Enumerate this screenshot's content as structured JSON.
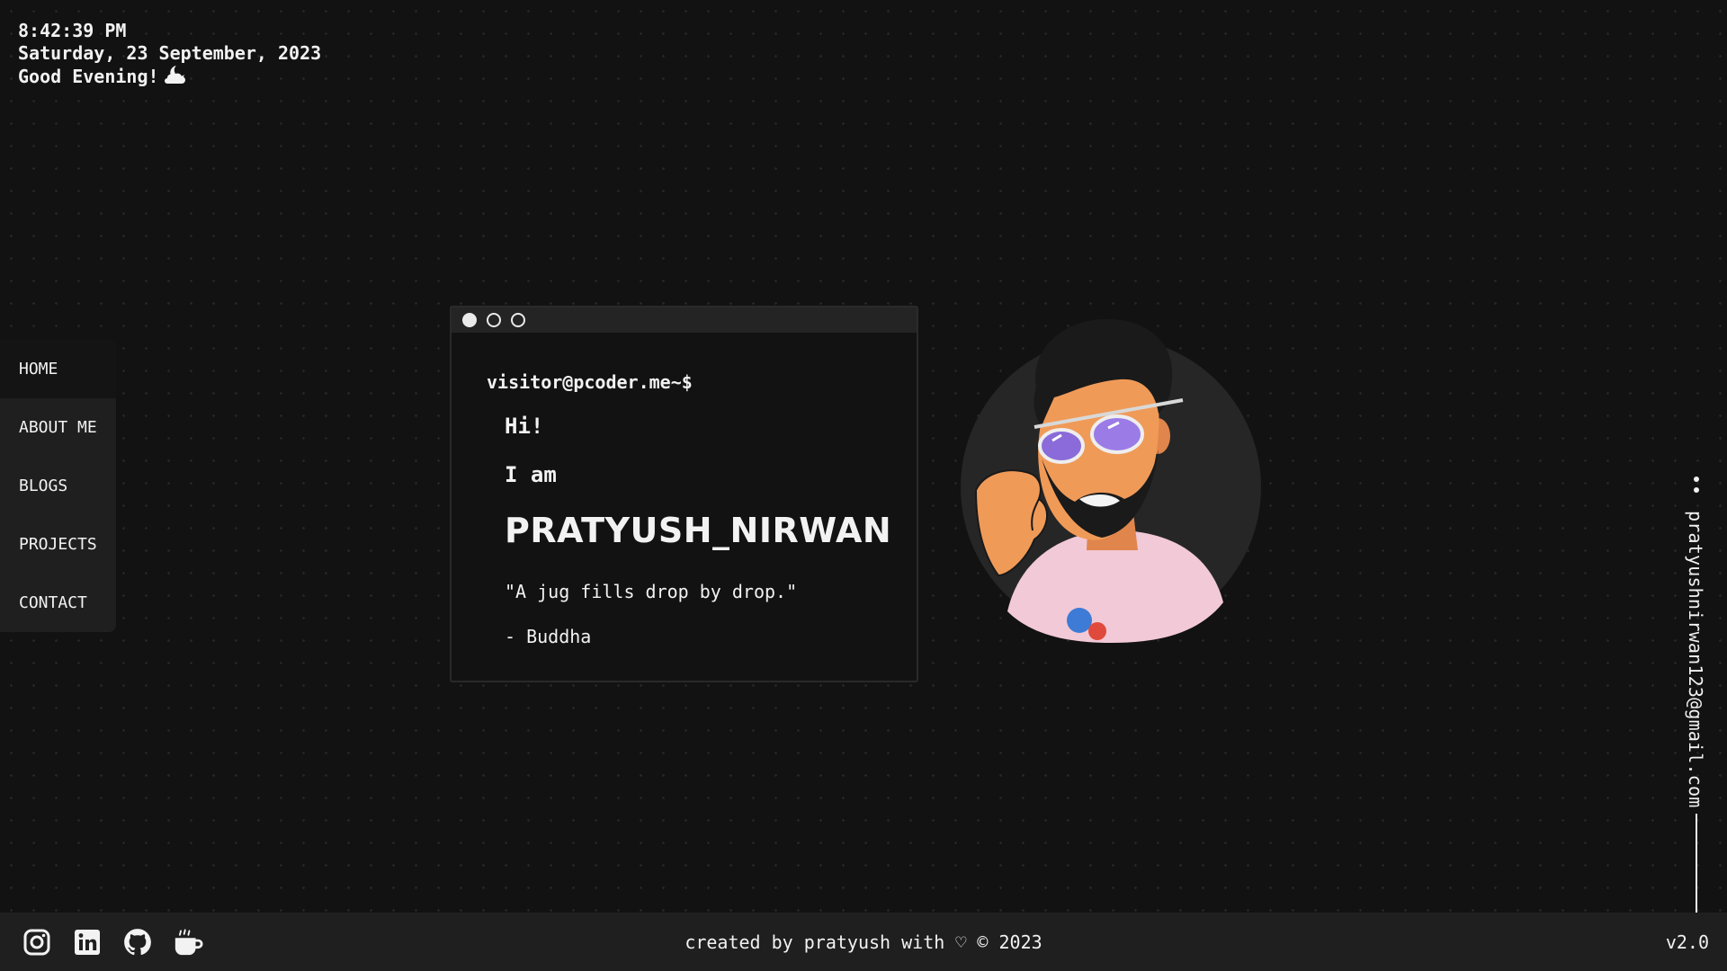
{
  "clock": {
    "time": "8:42:39 PM",
    "date": "Saturday, 23 September, 2023",
    "greeting": "Good Evening!"
  },
  "nav": {
    "items": [
      {
        "label": "HOME",
        "active": true
      },
      {
        "label": "ABOUT ME"
      },
      {
        "label": "BLOGS"
      },
      {
        "label": "PROJECTS"
      },
      {
        "label": "CONTACT"
      }
    ]
  },
  "terminal": {
    "prompt": "visitor@pcoder.me~$",
    "hi": "Hi!",
    "iam": "I am",
    "name": "PRATYUSH_NIRWAN",
    "quote": "\"A jug fills drop by drop.\"",
    "author": "- Buddha"
  },
  "email": "pratyushnirwan123@gmail.com",
  "footer": {
    "credit": "created by pratyush with ♡ © 2023",
    "version": "v2.0",
    "socials": [
      "instagram-icon",
      "linkedin-icon",
      "github-icon",
      "coffee-icon"
    ]
  },
  "colors": {
    "background": "#121212",
    "panel": "#1f1f1f",
    "text": "#f2f2f2"
  }
}
